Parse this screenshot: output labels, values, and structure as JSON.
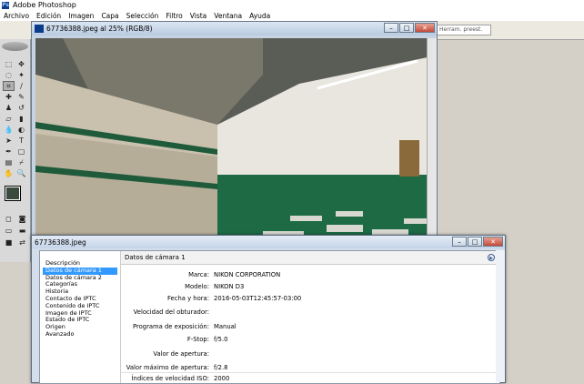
{
  "app": {
    "title": "Adobe Photoshop"
  },
  "menu": [
    "Archivo",
    "Edición",
    "Imagen",
    "Capa",
    "Selección",
    "Filtro",
    "Vista",
    "Ventana",
    "Ayuda"
  ],
  "palette_well": {
    "tab_label": "Herram. preest."
  },
  "document": {
    "title": "67736388.jpeg al 25% (RGB/8)"
  },
  "colors": {
    "foreground": "#3a4a3d",
    "background": "#ffffff",
    "selection": "#3399ff"
  },
  "file_info": {
    "window_title": "67736388.jpeg",
    "categories": [
      "Descripción",
      "Datos de cámara 1",
      "Datos de cámara 2",
      "Categorías",
      "Historia",
      "Contacto de IPTC",
      "Contenido de IPTC",
      "Imagen de IPTC",
      "Estado de IPTC",
      "Origen",
      "Avanzado"
    ],
    "selected_category_index": 1,
    "panel_title": "Datos de cámara 1",
    "fields": [
      {
        "label": "Marca:",
        "value": "NIKON CORPORATION"
      },
      {
        "label": "Modelo:",
        "value": "NIKON D3"
      },
      {
        "label": "Fecha y hora:",
        "value": "2016-05-03T12:45:57-03:00"
      },
      {
        "label": "Velocidad del obturador:",
        "value": ""
      },
      {
        "label": "Programa de exposición:",
        "value": "Manual"
      },
      {
        "label": "F-Stop:",
        "value": "f/5.0"
      },
      {
        "label": "Valor de apertura:",
        "value": ""
      },
      {
        "label": "Valor máximo de apertura:",
        "value": "f/2.8"
      },
      {
        "label": "Índices de velocidad ISO:",
        "value": "2000"
      }
    ]
  }
}
